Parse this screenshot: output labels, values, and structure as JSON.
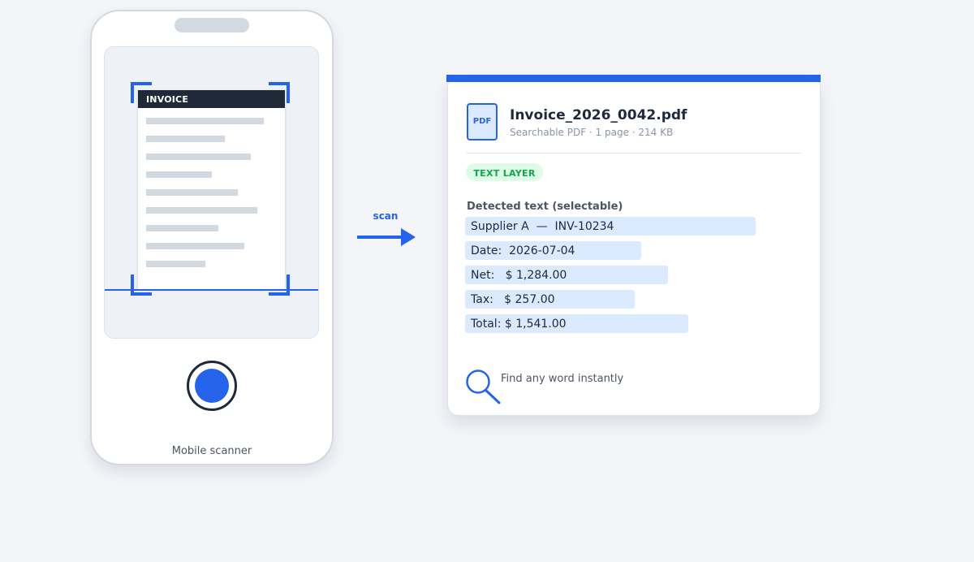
{
  "phone": {
    "document_title": "INVOICE",
    "caption": "Mobile scanner"
  },
  "arrow": {
    "label": "scan"
  },
  "pdf": {
    "icon_label": "PDF",
    "file_name": "Invoice_2026_0042.pdf",
    "meta": "Searchable PDF · 1 page · 214 KB",
    "badge": "TEXT LAYER",
    "detected_label": "Detected text (selectable)",
    "lines": [
      "Supplier A  —  INV-10234",
      "Date:  2026-07-04",
      "Net:   $ 1,284.00",
      "Tax:   $ 257.00",
      "Total: $ 1,541.00"
    ],
    "find_text": "Find any word instantly"
  },
  "colors": {
    "accent": "#2563eb",
    "highlight": "#dbeafe",
    "badge_bg": "#dcfce7",
    "badge_text": "#16a34a",
    "dark": "#1f2937"
  },
  "icons": {
    "document": "pdf-icon",
    "search": "magnifier-icon",
    "shutter": "camera-shutter-icon"
  }
}
